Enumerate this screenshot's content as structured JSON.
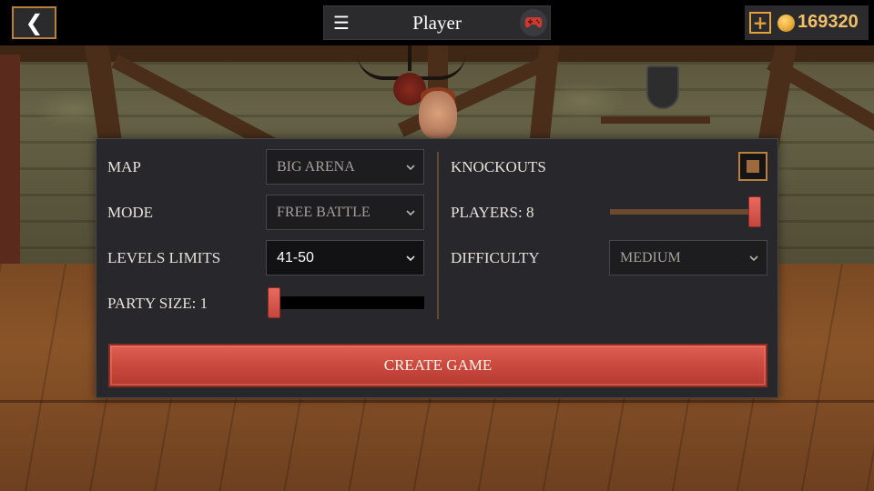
{
  "topbar": {
    "back_glyph": "❮",
    "menu_glyph": "☰",
    "player_name": "Player",
    "add_glyph": "+",
    "coins": "169320"
  },
  "settings": {
    "map": {
      "label": "MAP",
      "value": "BIG ARENA"
    },
    "mode": {
      "label": "MODE",
      "value": "FREE BATTLE"
    },
    "levels": {
      "label": "LEVELS LIMITS",
      "value": "41-50"
    },
    "party_size": {
      "label": "PARTY SIZE: 1",
      "value": 1,
      "min": 1,
      "max": 8
    },
    "knockouts": {
      "label": "KNOCKOUTS",
      "checked": true
    },
    "players": {
      "label": "PLAYERS: 8",
      "value": 8,
      "min": 1,
      "max": 8
    },
    "difficulty": {
      "label": "DIFFICULTY",
      "value": "MEDIUM"
    }
  },
  "create_button": "CREATE GAME",
  "colors": {
    "accent_gold": "#b9803a",
    "coin_text": "#f2c06a",
    "button_red": "#c8473d",
    "panel_bg": "#28282c"
  },
  "icons": [
    "back-arrow-icon",
    "menu-icon",
    "gamepad-icon",
    "add-coins-icon",
    "coin-icon",
    "chevron-down-icon"
  ]
}
